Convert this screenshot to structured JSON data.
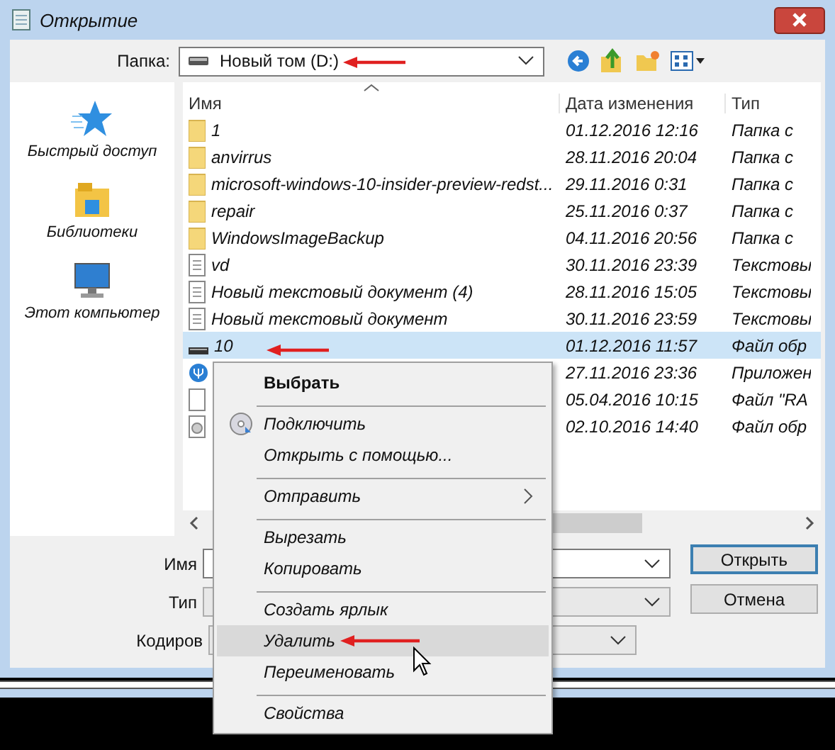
{
  "window": {
    "title": "Открытие"
  },
  "folder_bar": {
    "label": "Папка:",
    "value": "Новый том (D:)"
  },
  "sidebar": {
    "items": [
      {
        "kind": "star",
        "label": "Быстрый доступ"
      },
      {
        "kind": "library",
        "label": "Библиотеки"
      },
      {
        "kind": "computer",
        "label": "Этот компьютер"
      }
    ]
  },
  "file_list": {
    "columns": [
      "Имя",
      "Дата изменения",
      "Тип"
    ],
    "rows": [
      {
        "kind": "folder",
        "name": "1",
        "date": "01.12.2016 12:16",
        "type": "Папка с",
        "selected": false
      },
      {
        "kind": "folder",
        "name": "anvirrus",
        "date": "28.11.2016 20:04",
        "type": "Папка с",
        "selected": false
      },
      {
        "kind": "folder",
        "name": "microsoft-windows-10-insider-preview-redst...",
        "date": "29.11.2016 0:31",
        "type": "Папка с",
        "selected": false
      },
      {
        "kind": "folder",
        "name": "repair",
        "date": "25.11.2016 0:37",
        "type": "Папка с",
        "selected": false
      },
      {
        "kind": "folder",
        "name": "WindowsImageBackup",
        "date": "04.11.2016 20:56",
        "type": "Папка с",
        "selected": false
      },
      {
        "kind": "text",
        "name": "vd",
        "date": "30.11.2016 23:39",
        "type": "Текстовы",
        "selected": false
      },
      {
        "kind": "text",
        "name": "Новый текстовый документ (4)",
        "date": "28.11.2016 15:05",
        "type": "Текстовы",
        "selected": false
      },
      {
        "kind": "text",
        "name": "Новый текстовый документ",
        "date": "30.11.2016 23:59",
        "type": "Текстовы",
        "selected": false
      },
      {
        "kind": "drive",
        "name": "10",
        "date": "01.12.2016 11:57",
        "type": "Файл обр",
        "selected": true
      },
      {
        "kind": "app",
        "date": "27.11.2016 23:36",
        "type": "Приложен",
        "selected": false
      },
      {
        "kind": "blank",
        "date": "05.04.2016 10:15",
        "type": "Файл \"RA",
        "selected": false
      },
      {
        "kind": "image",
        "date": "02.10.2016 14:40",
        "type": "Файл обр",
        "selected": false
      }
    ]
  },
  "bottom_fields": [
    {
      "label": "Имя"
    },
    {
      "label": "Тип"
    },
    {
      "label": "Кодиров"
    }
  ],
  "buttons": [
    "Открыть",
    "Отмена"
  ],
  "context_menu": {
    "items": [
      {
        "kind": "item",
        "label": "Выбрать",
        "default": true,
        "highlighted": false
      },
      {
        "kind": "separator"
      },
      {
        "kind": "icon_item",
        "label": "Подключить",
        "highlighted": false
      },
      {
        "kind": "item",
        "label": "Открыть с помощью...",
        "highlighted": false
      },
      {
        "kind": "separator"
      },
      {
        "kind": "submenu_item",
        "label": "Отправить",
        "highlighted": false
      },
      {
        "kind": "separator"
      },
      {
        "kind": "item",
        "label": "Вырезать",
        "highlighted": false
      },
      {
        "kind": "item",
        "label": "Копировать",
        "highlighted": false
      },
      {
        "kind": "separator"
      },
      {
        "kind": "item",
        "label": "Создать ярлык",
        "highlighted": false
      },
      {
        "kind": "item",
        "label": "Удалить",
        "highlighted": true
      },
      {
        "kind": "item",
        "label": "Переименовать",
        "highlighted": false
      },
      {
        "kind": "separator"
      },
      {
        "kind": "item",
        "label": "Свойства",
        "highlighted": false
      }
    ]
  }
}
